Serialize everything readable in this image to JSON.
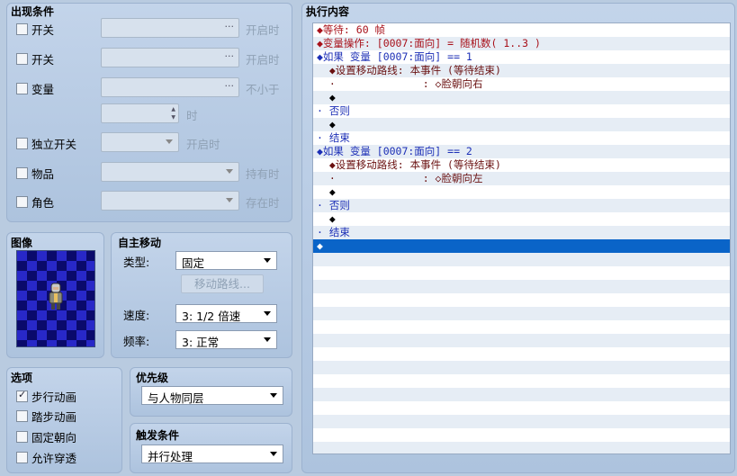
{
  "conditions": {
    "title": "出现条件",
    "switch1": {
      "label": "开关",
      "suffix": "开启时"
    },
    "switch2": {
      "label": "开关",
      "suffix": "开启时"
    },
    "variable": {
      "label": "变量",
      "suffix": "不小于",
      "time_suffix": "时"
    },
    "self_switch": {
      "label": "独立开关",
      "suffix": "开启时"
    },
    "item": {
      "label": "物品",
      "suffix": "持有时"
    },
    "actor": {
      "label": "角色",
      "suffix": "存在时"
    }
  },
  "image": {
    "title": "图像"
  },
  "autonomous": {
    "title": "自主移动",
    "type_label": "类型:",
    "type_value": "固定",
    "route_button": "移动路线...",
    "speed_label": "速度:",
    "speed_value": "3: 1/2 倍速",
    "freq_label": "频率:",
    "freq_value": "3: 正常"
  },
  "options": {
    "title": "选项",
    "items": [
      {
        "label": "步行动画",
        "checked": true
      },
      {
        "label": "踏步动画",
        "checked": false
      },
      {
        "label": "固定朝向",
        "checked": false
      },
      {
        "label": "允许穿透",
        "checked": false
      }
    ]
  },
  "priority": {
    "title": "优先级",
    "value": "与人物同层"
  },
  "trigger": {
    "title": "触发条件",
    "value": "并行处理"
  },
  "execution": {
    "title": "执行内容",
    "lines": [
      {
        "text": "◆等待: 60 帧",
        "color": "red"
      },
      {
        "text": "◆变量操作: [0007:面向] = 随机数( 1..3 )",
        "color": "red"
      },
      {
        "text": "◆如果 变量 [0007:面向] == 1",
        "color": "blue"
      },
      {
        "text": "  ◆设置移动路线: 本事件 (等待结束)",
        "color": "dark"
      },
      {
        "text": "  ·              : ◇脸朝向右",
        "color": "dark"
      },
      {
        "text": "  ◆",
        "color": "black"
      },
      {
        "text": "· 否则",
        "color": "blue"
      },
      {
        "text": "  ◆",
        "color": "black"
      },
      {
        "text": "· 结束",
        "color": "blue"
      },
      {
        "text": "◆如果 变量 [0007:面向] == 2",
        "color": "blue"
      },
      {
        "text": "  ◆设置移动路线: 本事件 (等待结束)",
        "color": "dark"
      },
      {
        "text": "  ·              : ◇脸朝向左",
        "color": "dark"
      },
      {
        "text": "  ◆",
        "color": "black"
      },
      {
        "text": "· 否则",
        "color": "blue"
      },
      {
        "text": "  ◆",
        "color": "black"
      },
      {
        "text": "· 结束",
        "color": "blue"
      },
      {
        "text": "◆",
        "color": "selected"
      }
    ]
  }
}
